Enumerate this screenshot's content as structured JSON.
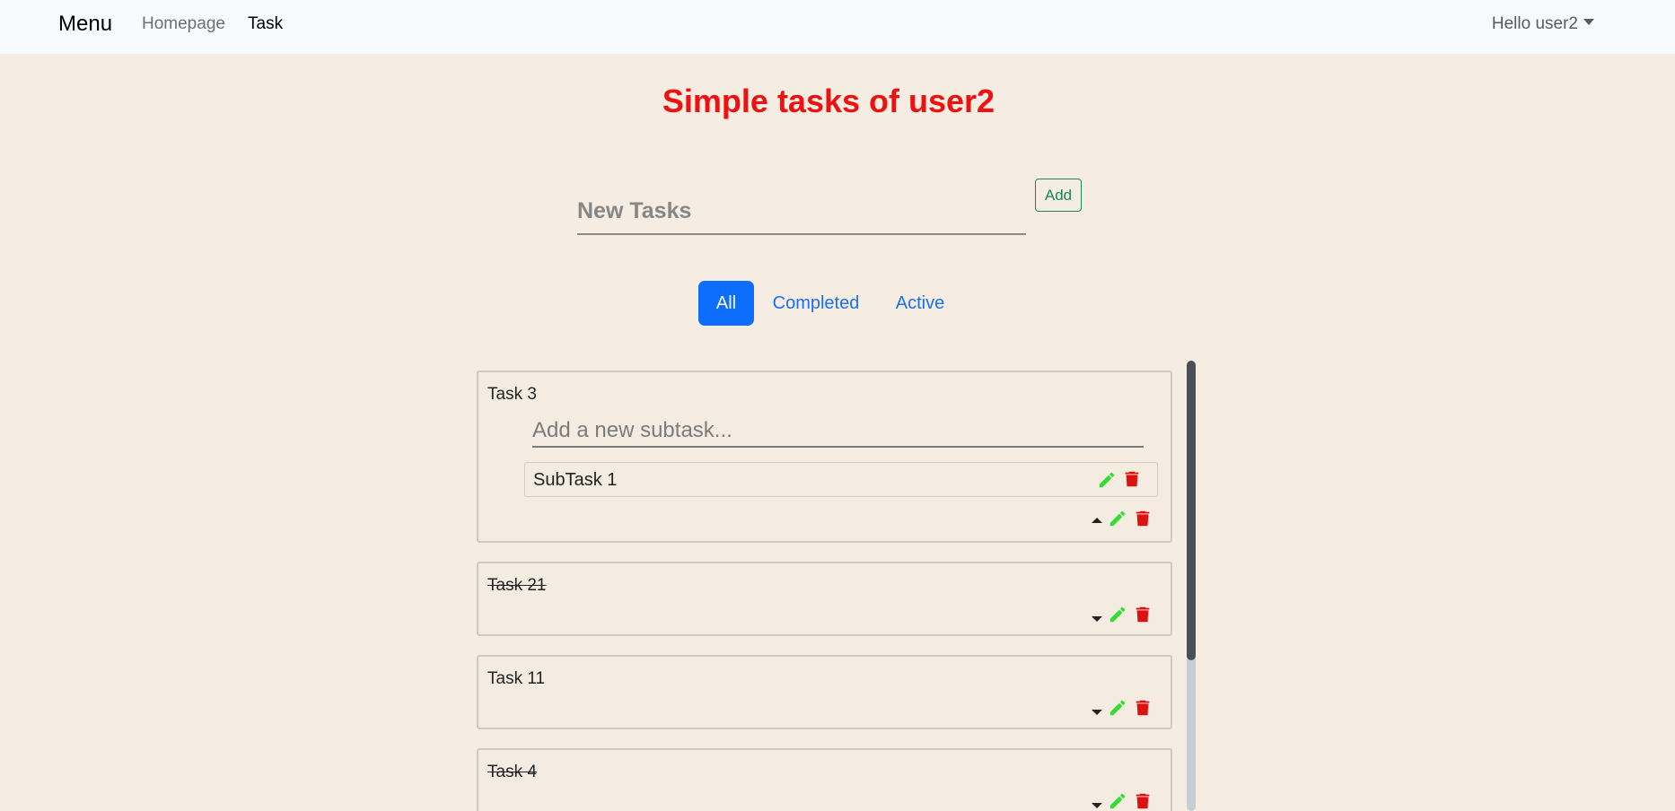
{
  "navbar": {
    "brand": "Menu",
    "links": [
      "Homepage",
      "Task"
    ],
    "user_menu": "Hello user2"
  },
  "page": {
    "title": "Simple tasks of user2"
  },
  "new_task": {
    "placeholder": "New Tasks",
    "add_label": "Add"
  },
  "filters": {
    "all": "All",
    "completed": "Completed",
    "active": "Active",
    "selected": "All"
  },
  "tasks": [
    {
      "name": "Task 3",
      "completed": false,
      "expanded": true,
      "subtask_placeholder": "Add a new subtask...",
      "subtasks": [
        "SubTask 1"
      ]
    },
    {
      "name": "Task 21",
      "completed": true,
      "expanded": false
    },
    {
      "name": "Task 11",
      "completed": false,
      "expanded": false
    },
    {
      "name": "Task 4",
      "completed": true,
      "expanded": false
    }
  ],
  "colors": {
    "background": "#f5ede1",
    "title": "#ee1111",
    "primary": "#0d6efd",
    "edit_icon": "#33dd33",
    "delete_icon": "#dd1111",
    "add_button": "#198754"
  },
  "icons": {
    "edit": "pencil-icon",
    "delete": "trash-icon",
    "expand": "caret-down-icon",
    "collapse": "caret-up-icon"
  }
}
